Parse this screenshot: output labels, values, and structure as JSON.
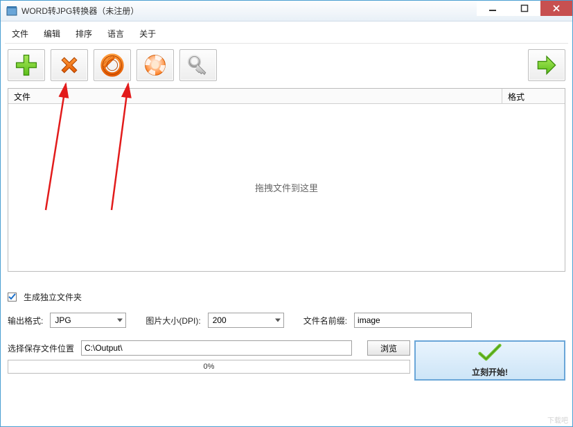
{
  "titlebar": {
    "title": "WORD转JPG转换器（未注册）"
  },
  "menubar": {
    "file": "文件",
    "edit": "编辑",
    "sort": "排序",
    "language": "语言",
    "about": "关于"
  },
  "toolbar": {
    "add": "add-icon",
    "delete": "delete-icon",
    "clear": "clear-icon",
    "help": "help-icon",
    "register": "key-icon",
    "go": "arrow-right-icon"
  },
  "filelist": {
    "col_file": "文件",
    "col_format": "格式",
    "drop_hint": "拖拽文件到这里"
  },
  "options": {
    "create_folder_label": "生成独立文件夹",
    "create_folder_checked": true,
    "out_format_label": "输出格式:",
    "out_format_value": "JPG",
    "dpi_label": "图片大小(DPI):",
    "dpi_value": "200",
    "prefix_label": "文件名前缀:",
    "prefix_value": "image",
    "save_loc_label": "选择保存文件位置",
    "save_loc_value": "C:\\Output\\",
    "browse_label": "浏览"
  },
  "progress": {
    "text": "0%"
  },
  "start": {
    "label": "立刻开始!"
  },
  "watermark": "下载吧"
}
